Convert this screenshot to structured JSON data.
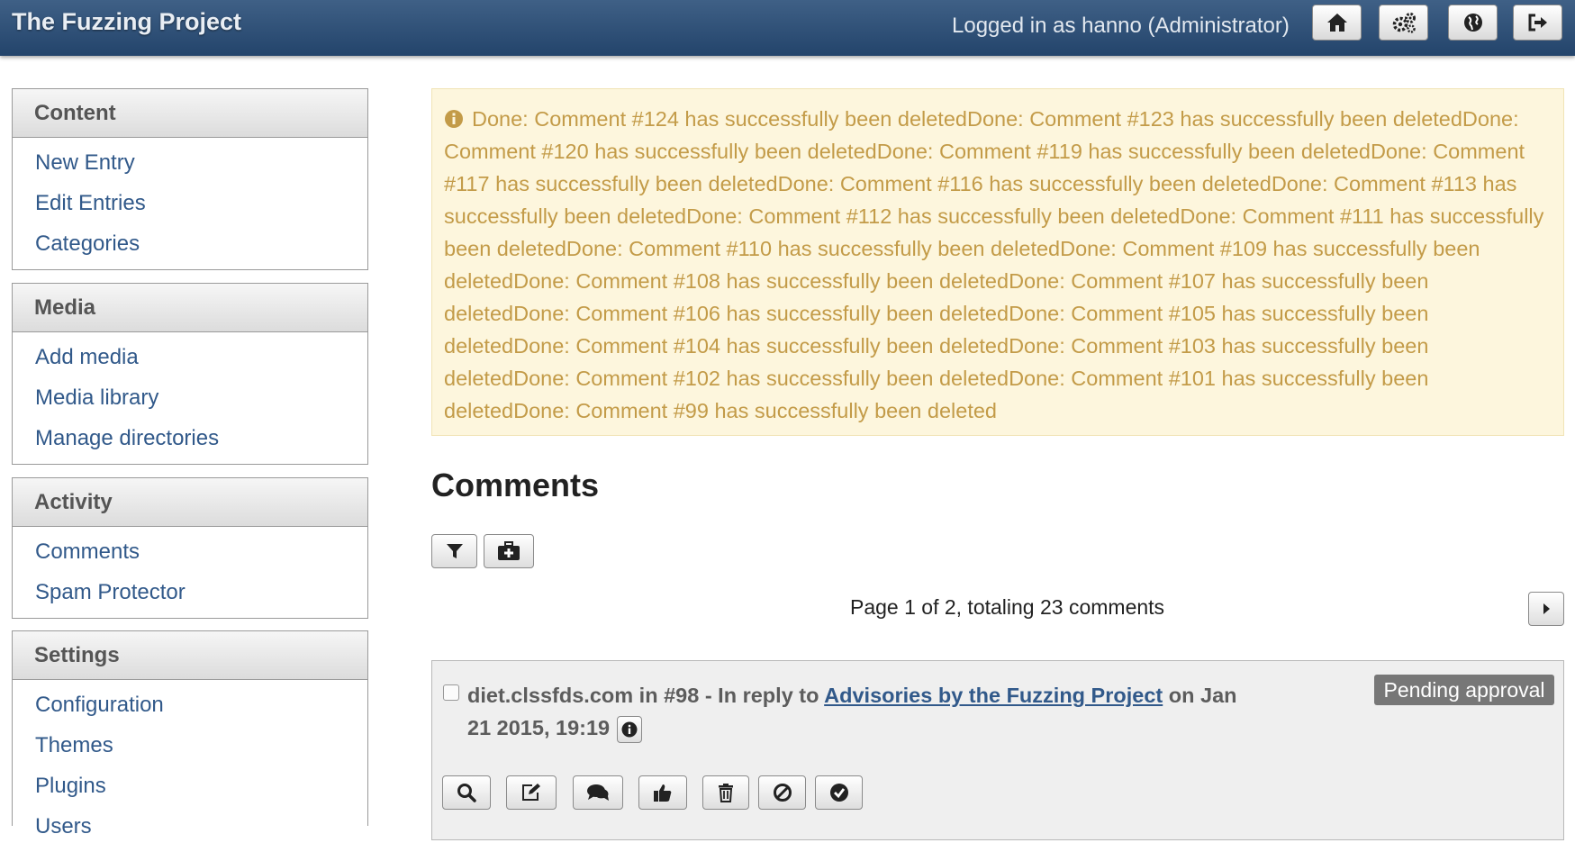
{
  "header": {
    "brand": "The Fuzzing Project",
    "logged_in": "Logged in as hanno (Administrator)",
    "buttons": [
      {
        "icon": "home-icon"
      },
      {
        "icon": "gears-icon"
      },
      {
        "icon": "globe-icon"
      },
      {
        "icon": "logout-icon"
      }
    ]
  },
  "sidebar": {
    "sections": [
      {
        "title": "Content",
        "items": [
          "New Entry",
          "Edit Entries",
          "Categories"
        ]
      },
      {
        "title": "Media",
        "items": [
          "Add media",
          "Media library",
          "Manage directories"
        ]
      },
      {
        "title": "Activity",
        "items": [
          "Comments",
          "Spam Protector"
        ]
      },
      {
        "title": "Settings",
        "items": [
          "Configuration",
          "Themes",
          "Plugins",
          "Users"
        ]
      }
    ]
  },
  "notice": {
    "icon": "info-circle-icon",
    "text": "Done: Comment #124 has successfully been deletedDone: Comment #123 has successfully been deletedDone: Comment #120 has successfully been deletedDone: Comment #119 has successfully been deletedDone: Comment #117 has successfully been deletedDone: Comment #116 has successfully been deletedDone: Comment #113 has successfully been deletedDone: Comment #112 has successfully been deletedDone: Comment #111 has successfully been deletedDone: Comment #110 has successfully been deletedDone: Comment #109 has successfully been deletedDone: Comment #108 has successfully been deletedDone: Comment #107 has successfully been deletedDone: Comment #106 has successfully been deletedDone: Comment #105 has successfully been deletedDone: Comment #104 has successfully been deletedDone: Comment #103 has successfully been deletedDone: Comment #102 has successfully been deletedDone: Comment #101 has successfully been deletedDone: Comment #99 has successfully been deleted"
  },
  "main": {
    "title": "Comments",
    "toolbar": [
      {
        "icon": "filter-icon"
      },
      {
        "icon": "first-aid-kit-icon"
      }
    ],
    "paging": "Page 1 of 2, totaling 23 comments",
    "next_icon": "caret-right-icon"
  },
  "comment": {
    "author": "diet.clssfds.com in #98 - In reply to",
    "entry_link": "Advisories by the Fuzzing Project",
    "date": "on Jan 21 2015, 19:19",
    "status": "Pending approval",
    "actions": [
      {
        "icon": "magnifier-icon"
      },
      {
        "icon": "edit-icon"
      },
      {
        "icon": "comments-icon"
      },
      {
        "icon": "thumbs-up-icon"
      },
      {
        "icon": "trash-icon"
      },
      {
        "icon": "ban-icon"
      },
      {
        "icon": "check-circle-icon"
      }
    ]
  },
  "colors": {
    "topbar": "#2f5078",
    "link": "#31598a",
    "notice_bg": "#fdf6dd",
    "notice_text": "#c39b48",
    "badge": "#777777"
  }
}
